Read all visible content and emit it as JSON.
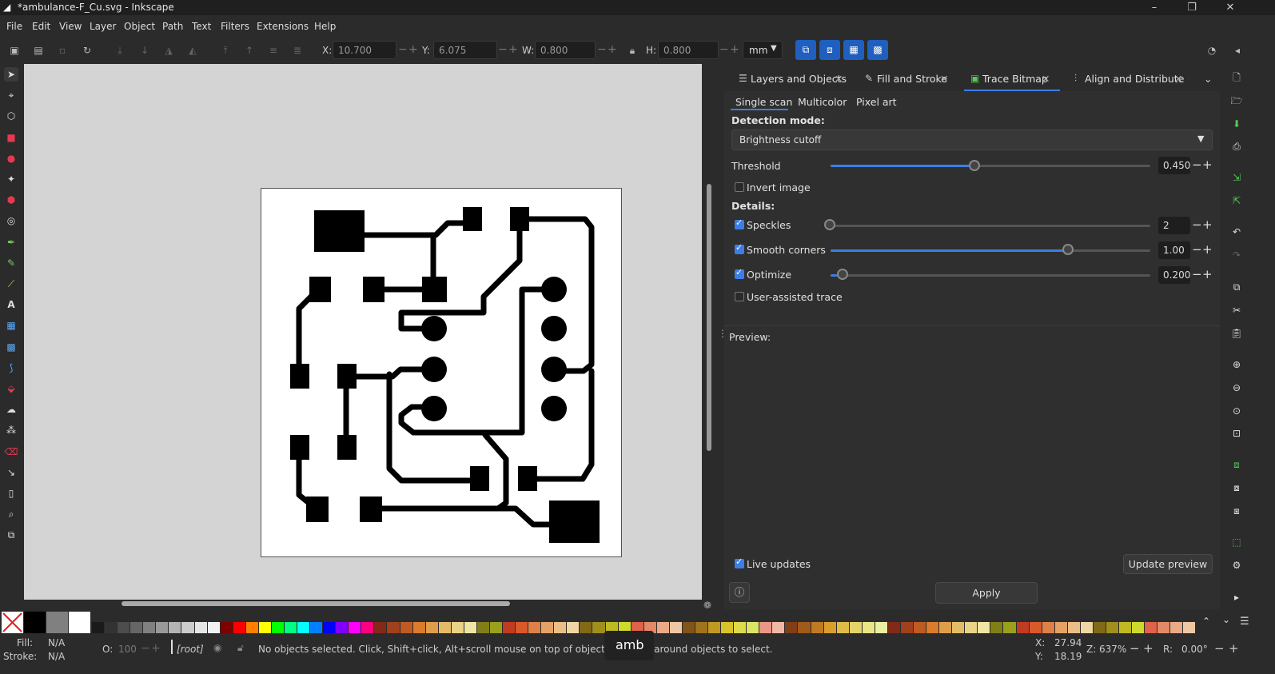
{
  "window": {
    "title": "*ambulance-F_Cu.svg - Inkscape",
    "minimize": "–",
    "restore": "❐",
    "close": "✕"
  },
  "menu": [
    "File",
    "Edit",
    "View",
    "Layer",
    "Object",
    "Path",
    "Text",
    "Filters",
    "Extensions",
    "Help"
  ],
  "toolbar": {
    "x_label": "X:",
    "x_value": "10.700",
    "y_label": "Y:",
    "y_value": "6.075",
    "w_label": "W:",
    "w_value": "0.800",
    "h_label": "H:",
    "h_value": "0.800",
    "unit": "mm"
  },
  "panel": {
    "tabs": [
      {
        "label": "Layers and Objects"
      },
      {
        "label": "Fill and Stroke"
      },
      {
        "label": "Trace Bitmap"
      },
      {
        "label": "Align and Distribute"
      }
    ],
    "active_tab": "Trace Bitmap",
    "subtabs": [
      "Single scan",
      "Multicolor",
      "Pixel art"
    ],
    "detection_mode_label": "Detection mode:",
    "detection_mode_value": "Brightness cutoff",
    "threshold_label": "Threshold",
    "threshold_value": "0.450",
    "threshold_level": 0.45,
    "invert_image_label": "Invert image",
    "invert_image_checked": false,
    "details_label": "Details:",
    "speckles_label": "Speckles",
    "speckles_value": "2",
    "speckles_checked": true,
    "smooth_corners_label": "Smooth corners",
    "smooth_corners_value": "1.00",
    "smooth_corners_checked": true,
    "optimize_label": "Optimize",
    "optimize_value": "0.200",
    "optimize_checked": true,
    "user_assisted_label": "User-assisted trace",
    "user_assisted_checked": false,
    "preview_label": "Preview:",
    "live_updates_label": "Live updates",
    "live_updates_checked": true,
    "update_preview_label": "Update preview",
    "apply_label": "Apply"
  },
  "status": {
    "fill_label": "Fill:",
    "fill_value": "N/A",
    "stroke_label": "Stroke:",
    "stroke_value": "N/A",
    "opacity_label": "O:",
    "opacity_value": "100",
    "layer": "[root]",
    "message": "No objects selected. Click, Shift+click, Alt+scroll mouse on top of objects, or drag around objects to select.",
    "tooltip": "amb",
    "cursor_x_label": "X:",
    "cursor_x": "27.94",
    "cursor_y_label": "Y:",
    "cursor_y": "18.19",
    "zoom_label": "Z:",
    "zoom": "637%",
    "rotate_label": "R:",
    "rotate": "0.00°"
  },
  "colors": {
    "accent": "#3d7ee6",
    "canvas": "#d4d4d4",
    "page": "#ffffff",
    "trace": "#000000"
  }
}
